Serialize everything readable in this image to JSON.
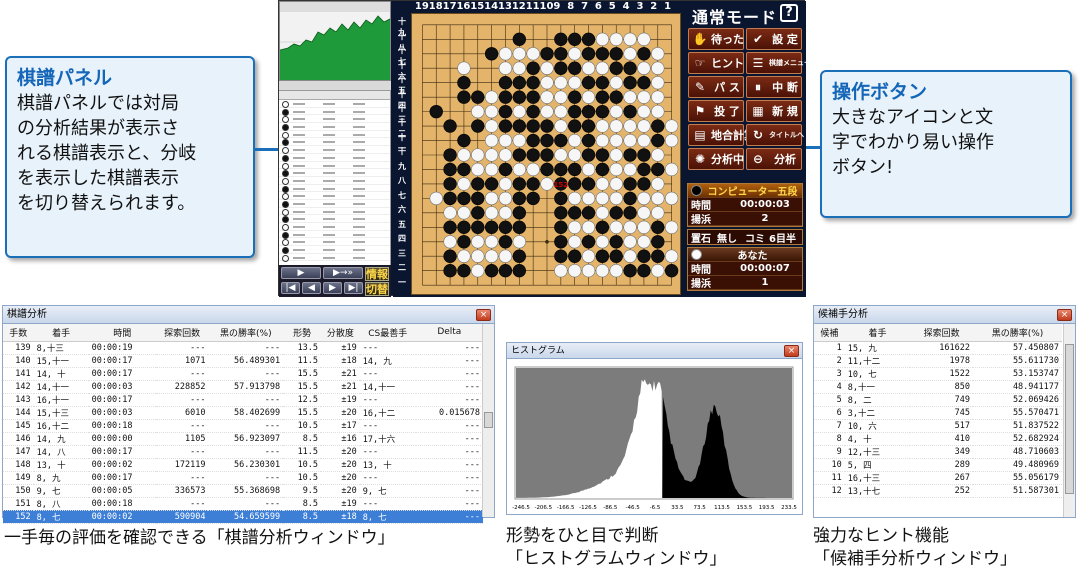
{
  "callout_left": {
    "title": "棋譜パネル",
    "lines": [
      "棋譜パネルでは対局",
      "の分析結果が表示さ",
      "れる棋譜表示と、分岐",
      "を表示した棋譜表示",
      "を切り替えられます。"
    ]
  },
  "callout_right": {
    "title": "操作ボタン",
    "lines": [
      "大きなアイコンと文",
      "字でわかり易い操作",
      "ボタン!"
    ]
  },
  "game": {
    "col_labels": [
      "19",
      "18",
      "17",
      "16",
      "15",
      "14",
      "13",
      "12",
      "11",
      "10",
      "9",
      "8",
      "7",
      "6",
      "5",
      "4",
      "3",
      "2",
      "1"
    ],
    "row_labels": [
      "十九",
      "十八",
      "十七",
      "十六",
      "十五",
      "十四",
      "十三",
      "十二",
      "十一",
      "十",
      "九",
      "八",
      "七",
      "六",
      "五",
      "四",
      "三",
      "二",
      "一"
    ],
    "mode_title": "通常モード",
    "help": "?",
    "buttons": [
      {
        "label": "待った",
        "icon": "hand-icon"
      },
      {
        "label": "設 定",
        "icon": "settings-icon"
      },
      {
        "label": "ヒント",
        "icon": "hint-icon"
      },
      {
        "label": "棋譜メニュー",
        "icon": "list-icon"
      },
      {
        "label": "パ ス",
        "icon": "pass-icon"
      },
      {
        "label": "中 断",
        "icon": "pause-icon"
      },
      {
        "label": "投 了",
        "icon": "flag-icon"
      },
      {
        "label": "新 規",
        "icon": "grid-icon"
      },
      {
        "label": "地合計算",
        "icon": "count-icon"
      },
      {
        "label": "タイトルへ",
        "icon": "return-icon"
      },
      {
        "label": "分析中",
        "icon": "analysis-icon"
      },
      {
        "label": "分析",
        "icon": "minus-icon"
      }
    ],
    "computer": {
      "name": "コンピューター五段",
      "time_label": "時間",
      "time": "00:00:03",
      "captures_label": "揚浜",
      "captures": "2"
    },
    "handicap": {
      "label": "置石",
      "value": "無し",
      "komi_label": "コミ",
      "komi": "6目半"
    },
    "player": {
      "name": "あなた",
      "time_label": "時間",
      "time": "00:00:07",
      "captures_label": "揚浜",
      "captures": "1"
    },
    "info_button": "情報",
    "switch_button": "切替",
    "last_move_marker": "152"
  },
  "analysis_window": {
    "title": "棋譜分析",
    "close": "×",
    "columns": [
      "手数",
      "着手",
      "時間",
      "探索回数",
      "黒の勝率(%)",
      "形勢",
      "分散度",
      "CS最善手",
      "Delta"
    ],
    "rows": [
      [
        "139",
        "8,十三",
        "00:00:19",
        "---",
        "---",
        "13.5",
        "±19",
        "---",
        "---"
      ],
      [
        "140",
        "15,十一",
        "00:00:17",
        "1071",
        "56.489301",
        "11.5",
        "±18",
        "14, 九",
        "---"
      ],
      [
        "141",
        "14, 十",
        "00:00:17",
        "---",
        "---",
        "15.5",
        "±21",
        "---",
        "---"
      ],
      [
        "142",
        "14,十一",
        "00:00:03",
        "228852",
        "57.913798",
        "15.5",
        "±21",
        "14,十一",
        "---"
      ],
      [
        "143",
        "16,十一",
        "00:00:17",
        "---",
        "---",
        "12.5",
        "±19",
        "---",
        "---"
      ],
      [
        "144",
        "15,十三",
        "00:00:03",
        "6010",
        "58.402699",
        "15.5",
        "±20",
        "16,十二",
        "0.015678"
      ],
      [
        "145",
        "16,十二",
        "00:00:18",
        "---",
        "---",
        "10.5",
        "±17",
        "---",
        "---"
      ],
      [
        "146",
        "14, 九",
        "00:00:00",
        "1105",
        "56.923097",
        "8.5",
        "±16",
        "17,十六",
        "---"
      ],
      [
        "147",
        "14, 八",
        "00:00:17",
        "---",
        "---",
        "11.5",
        "±20",
        "---",
        "---"
      ],
      [
        "148",
        "13, 十",
        "00:00:02",
        "172119",
        "56.230301",
        "10.5",
        "±20",
        "13, 十",
        "---"
      ],
      [
        "149",
        "8, 九",
        "00:00:17",
        "---",
        "---",
        "10.5",
        "±20",
        "---",
        "---"
      ],
      [
        "150",
        "9, 七",
        "00:00:05",
        "336573",
        "55.368698",
        "9.5",
        "±20",
        "9, 七",
        "---"
      ],
      [
        "151",
        "8, 八",
        "00:00:18",
        "---",
        "---",
        "8.5",
        "±19",
        "---",
        "---"
      ],
      [
        "152",
        "8, 七",
        "00:00:02",
        "590904",
        "54.659599",
        "8.5",
        "±18",
        "8, 七",
        "---"
      ]
    ]
  },
  "histogram_window": {
    "title": "ヒストグラム",
    "close": "×",
    "x_ticks": [
      "-246.5",
      "-206.5",
      "-166.5",
      "-126.5",
      "-86.5",
      "-46.5",
      "-6.5",
      "33.5",
      "73.5",
      "113.5",
      "153.5",
      "193.5",
      "233.5"
    ]
  },
  "candidate_window": {
    "title": "候補手分析",
    "close": "×",
    "columns": [
      "候補",
      "着手",
      "探索回数",
      "黒の勝率(%)"
    ],
    "rows": [
      [
        "1",
        "15, 九",
        "161622",
        "57.450807"
      ],
      [
        "2",
        "11,十二",
        "1978",
        "55.611730"
      ],
      [
        "3",
        "10, 七",
        "1522",
        "53.153747"
      ],
      [
        "4",
        "8,十一",
        "850",
        "48.941177"
      ],
      [
        "5",
        "8, 二",
        "749",
        "52.069426"
      ],
      [
        "6",
        "3,十二",
        "745",
        "55.570471"
      ],
      [
        "7",
        "10, 六",
        "517",
        "51.837522"
      ],
      [
        "8",
        "4, 十",
        "410",
        "52.682924"
      ],
      [
        "9",
        "12,十三",
        "349",
        "48.710603"
      ],
      [
        "10",
        "5, 四",
        "289",
        "49.480969"
      ],
      [
        "11",
        "16,十三",
        "267",
        "55.056179"
      ],
      [
        "12",
        "13,十七",
        "252",
        "51.587301"
      ]
    ]
  },
  "captions": {
    "analysis": "一手毎の評価を確認できる「棋譜分析ウィンドウ」",
    "histogram_1": "形勢をひと目で判断",
    "histogram_2": "「ヒストグラムウィンドウ」",
    "candidate_1": "強力なヒント機能",
    "candidate_2": "「候補手分析ウィンドウ」"
  }
}
